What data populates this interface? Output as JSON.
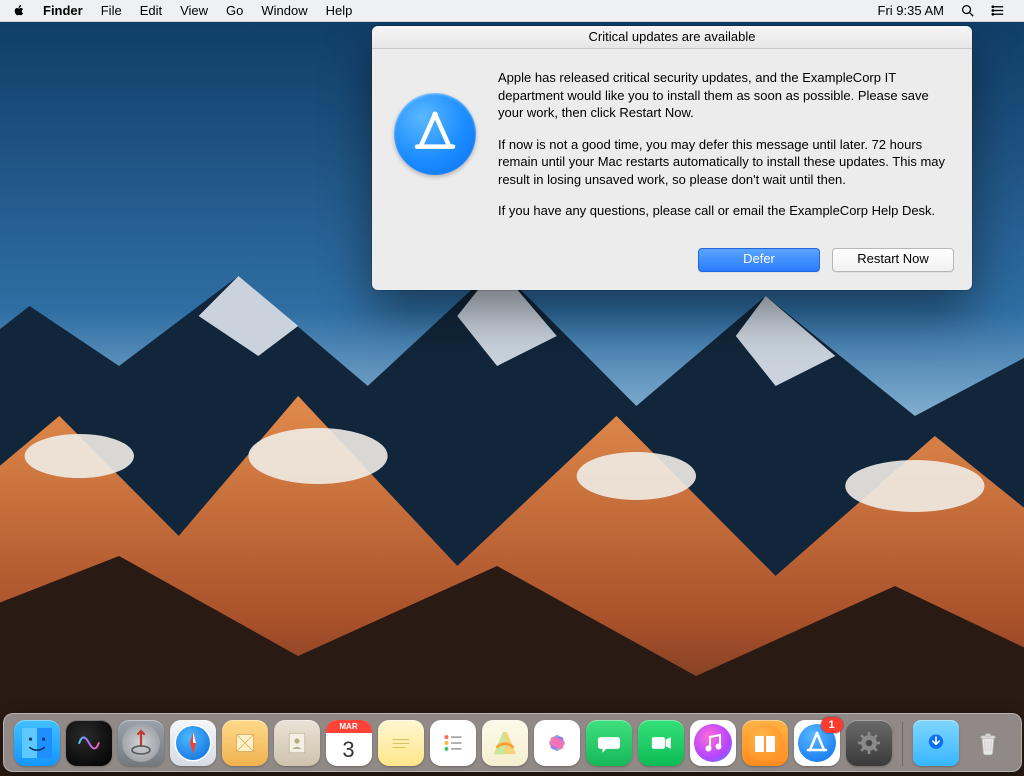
{
  "menubar": {
    "app": "Finder",
    "items": [
      "File",
      "Edit",
      "View",
      "Go",
      "Window",
      "Help"
    ],
    "clock": "Fri 9:35 AM"
  },
  "dialog": {
    "title": "Critical updates are available",
    "p1": "Apple has released critical security updates, and the ExampleCorp IT department would like you to install them as soon as possible. Please save your work, then click Restart Now.",
    "p2": "If now is not a good time, you may defer this message until later. 72 hours remain until your Mac restarts automatically to install these updates. This may result in losing unsaved work, so please don't wait until then.",
    "p3": "If you have any questions, please call or email the ExampleCorp Help Desk.",
    "defer_label": "Defer",
    "restart_label": "Restart Now"
  },
  "dock": {
    "apps": [
      {
        "name": "finder",
        "label": "Finder"
      },
      {
        "name": "siri",
        "label": "Siri"
      },
      {
        "name": "launchpad",
        "label": "Launchpad"
      },
      {
        "name": "safari",
        "label": "Safari"
      },
      {
        "name": "mail",
        "label": "Mail"
      },
      {
        "name": "contacts",
        "label": "Contacts"
      },
      {
        "name": "calendar",
        "label": "Calendar",
        "cal_month": "MAR",
        "cal_day": "3"
      },
      {
        "name": "notes",
        "label": "Notes"
      },
      {
        "name": "reminders",
        "label": "Reminders"
      },
      {
        "name": "maps",
        "label": "Maps"
      },
      {
        "name": "photos",
        "label": "Photos"
      },
      {
        "name": "messages",
        "label": "Messages"
      },
      {
        "name": "facetime",
        "label": "FaceTime"
      },
      {
        "name": "itunes",
        "label": "iTunes"
      },
      {
        "name": "ibooks",
        "label": "iBooks"
      },
      {
        "name": "appstore",
        "label": "App Store",
        "badge": "1"
      },
      {
        "name": "sysprefs",
        "label": "System Preferences"
      }
    ],
    "right": [
      {
        "name": "downloads",
        "label": "Downloads"
      },
      {
        "name": "trash",
        "label": "Trash"
      }
    ]
  }
}
